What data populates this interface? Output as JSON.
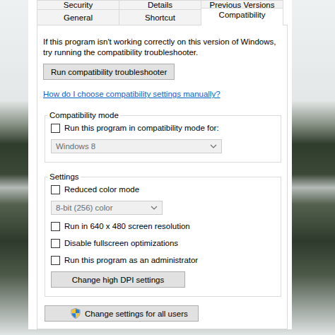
{
  "tab_rows": [
    [
      {
        "label": "Security",
        "selected": false
      },
      {
        "label": "Details",
        "selected": false
      },
      {
        "label": "Previous Versions",
        "selected": false
      }
    ],
    [
      {
        "label": "General",
        "selected": false
      },
      {
        "label": "Shortcut",
        "selected": false
      },
      {
        "label": "Compatibility",
        "selected": true
      }
    ]
  ],
  "intro": "If this program isn't working correctly on this version of Windows, try running the compatibility troubleshooter.",
  "troubleshooter_button": "Run compatibility troubleshooter",
  "help_link": "How do I choose compatibility settings manually?",
  "compatibility_mode": {
    "title": "Compatibility mode",
    "items": [
      {
        "kind": "checkbox",
        "label": "Run this program in compatibility mode for:",
        "checked": false
      },
      {
        "kind": "dropdown",
        "value": "Windows 8",
        "disabled": true
      }
    ]
  },
  "settings": {
    "title": "Settings",
    "items": [
      {
        "kind": "checkbox",
        "label": "Reduced color mode",
        "checked": false
      },
      {
        "kind": "dropdown",
        "value": "8-bit (256) color",
        "disabled": true
      },
      {
        "kind": "checkbox",
        "label": "Run in 640 x 480 screen resolution",
        "checked": false
      },
      {
        "kind": "checkbox",
        "label": "Disable fullscreen optimizations",
        "checked": false
      },
      {
        "kind": "checkbox",
        "label": "Run this program as an administrator",
        "checked": false
      },
      {
        "kind": "button",
        "label": "Change high DPI settings"
      }
    ]
  },
  "all_users_button": "Change settings for all users"
}
